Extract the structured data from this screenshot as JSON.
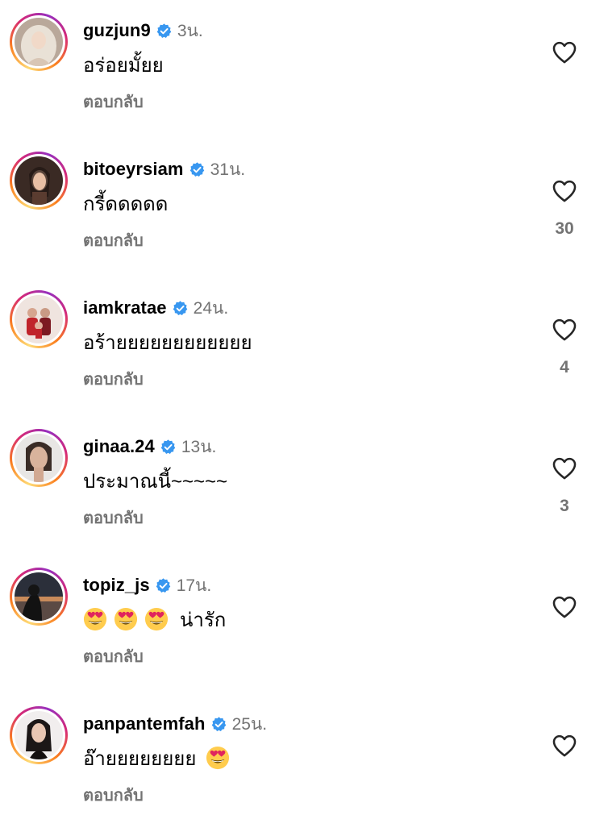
{
  "colors": {
    "verified": "#3897f0",
    "muted": "#737373",
    "ring_start": "#feda75",
    "ring_mid": "#d62976",
    "ring_end": "#962fbf"
  },
  "icons": {
    "like": "heart-outline-icon",
    "verified": "verified-badge-icon",
    "emoji": "heart-eyes-emoji"
  },
  "comments": [
    {
      "username": "guzjun9",
      "time": "3น.",
      "text": "อร่อยมั้ยย",
      "reply": "ตอบกลับ",
      "likes": ""
    },
    {
      "username": "bitoeyrsiam",
      "time": "31น.",
      "text": "กรี้ดดดดด",
      "reply": "ตอบกลับ",
      "likes": "30"
    },
    {
      "username": "iamkratae",
      "time": "24น.",
      "text": "อร้ายยยยยยยยยยยย",
      "reply": "ตอบกลับ",
      "likes": "4"
    },
    {
      "username": "ginaa.24",
      "time": "13น.",
      "text": "ประมาณนี้~~~~~",
      "reply": "ตอบกลับ",
      "likes": "3"
    },
    {
      "username": "topiz_js",
      "time": "17น.",
      "text": "น่ารัก",
      "reply": "ตอบกลับ",
      "likes": ""
    },
    {
      "username": "panpantemfah",
      "time": "25น.",
      "text": "อ๊ายยยยยยยย",
      "reply": "ตอบกลับ",
      "likes": ""
    }
  ]
}
